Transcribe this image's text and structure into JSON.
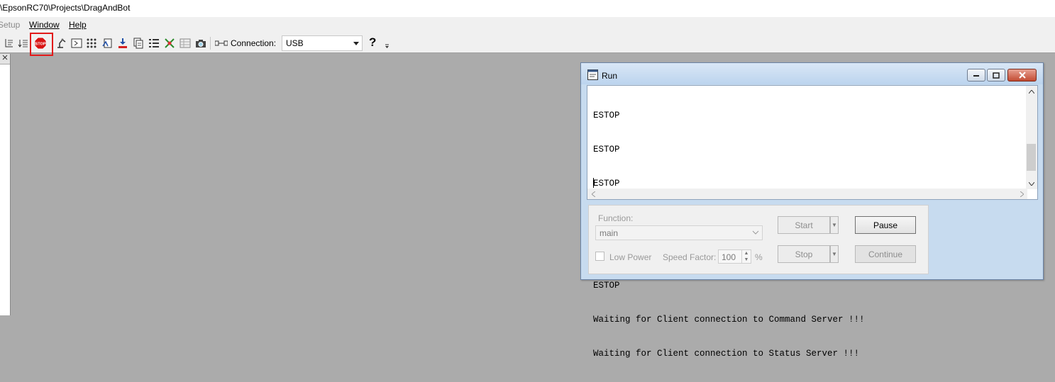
{
  "title_bar": {
    "path": "\\EpsonRC70\\Projects\\DragAndBot"
  },
  "menu": {
    "setup": "Setup",
    "window": "Window",
    "help": "Help"
  },
  "toolbar": {
    "connection_label": "Connection:",
    "connection_value": "USB",
    "help_symbol": "?",
    "stop_icon_text": "STOP"
  },
  "run_window": {
    "title": "Run",
    "console_lines": [
      "ESTOP",
      "ESTOP",
      "ESTOP",
      "ESTOP",
      "ESTOP",
      "ESTOP",
      "Waiting for Client connection to Command Server !!!",
      "Waiting for Client connection to Status Server !!!"
    ],
    "function_label": "Function:",
    "function_value": "main",
    "low_power_label": "Low Power",
    "speed_factor_label": "Speed Factor:",
    "speed_factor_value": "100",
    "percent_sign": "%",
    "start_label": "Start",
    "pause_label": "Pause",
    "stop_label": "Stop",
    "continue_label": "Continue"
  },
  "colors": {
    "workspace": "#ababab",
    "stop_highlight": "#e21a1a",
    "window_frame": "#c7dbef"
  }
}
